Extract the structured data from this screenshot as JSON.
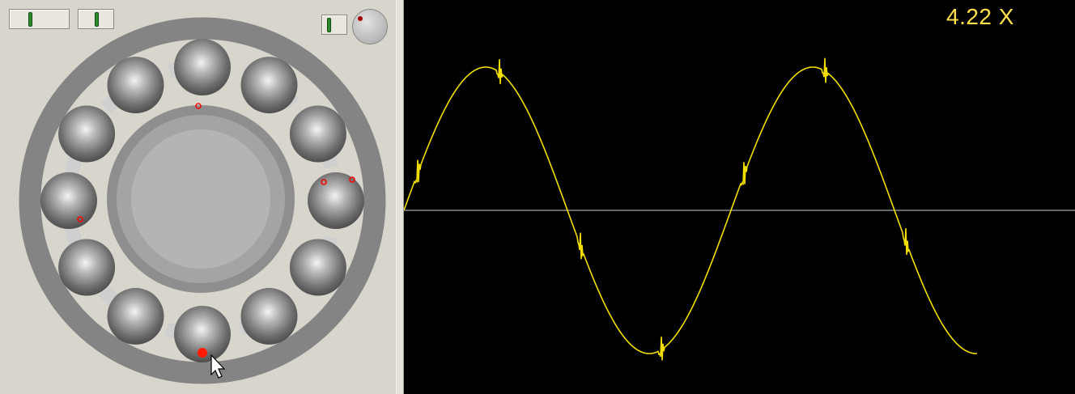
{
  "scope": {
    "readout": "4.22 X",
    "trace_color": "#f2df00",
    "baseline_color": "#cfcfcf",
    "background_color": "#000000"
  },
  "bearing": {
    "ball_count": 12,
    "outer_ring_color": "#848484",
    "ball_color": "#7b7b7b",
    "defect_marker_color": "#ff0000"
  },
  "controls": {
    "slider_1_icon": "slider-thumb-icon",
    "slider_2_icon": "slider-thumb-icon",
    "slider_3_icon": "slider-thumb-icon",
    "knob_icon": "rotary-knob-icon",
    "cursor_icon": "arrow-cursor-icon"
  }
}
